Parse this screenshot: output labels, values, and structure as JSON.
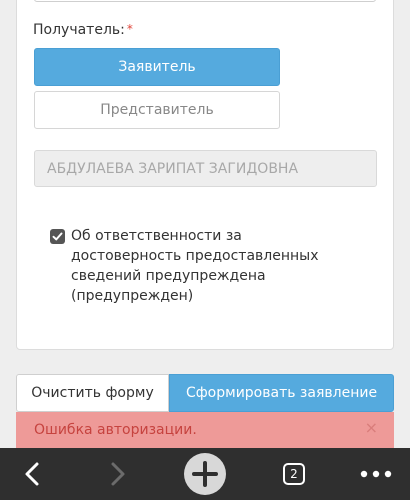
{
  "form": {
    "recipient_label": "Получатель:",
    "required_mark": "*",
    "applicant_button": "Заявитель",
    "representative_button": "Представитель",
    "name_value": "АБДУЛАЕВА ЗАРИПАТ ЗАГИДОВНА",
    "checkbox_checked": true,
    "checkbox_text": "Об ответственности за достоверность предоставленных сведений предупреждена (предупрежден)"
  },
  "actions": {
    "clear_label": "Очистить форму",
    "submit_label": "Сформировать заявление"
  },
  "alert": {
    "message": "Ошибка авторизации.",
    "close_glyph": "×"
  },
  "browser_toolbar": {
    "tab_count": "2",
    "icons": [
      "back-icon",
      "forward-icon",
      "new-tab-icon",
      "tabs-icon",
      "menu-icon"
    ]
  },
  "colors": {
    "primary": "#55aade",
    "alert_bg": "#ee9a98",
    "alert_text": "#c6433f",
    "toolbar_bg": "#2f2f2f"
  }
}
